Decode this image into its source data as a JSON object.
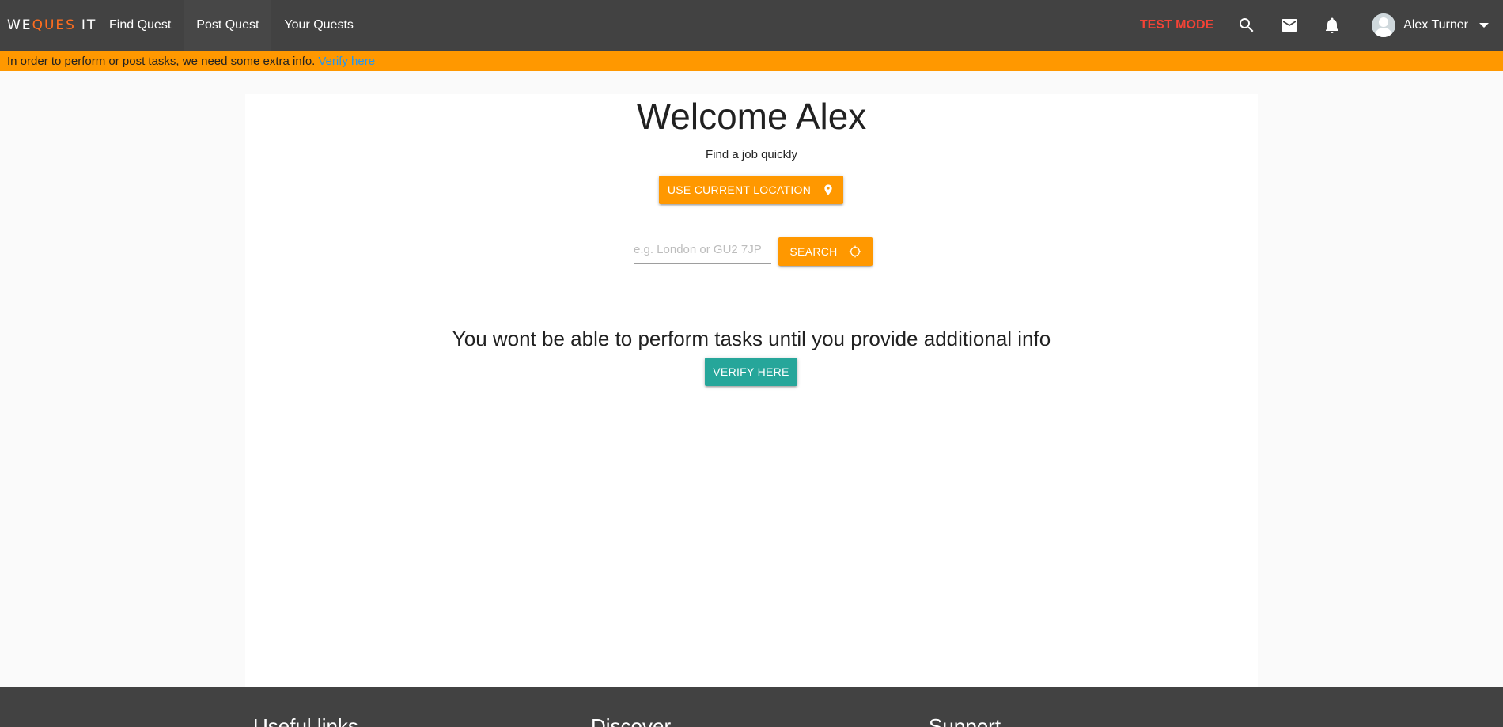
{
  "navbar": {
    "logo": {
      "part1": "WE",
      "part2": "QUES",
      "part3": "IT"
    },
    "items": [
      {
        "label": "Find Quest"
      },
      {
        "label": "Post Quest"
      },
      {
        "label": "Your Quests"
      }
    ],
    "test_mode_label": "TEST MODE",
    "icons": [
      "search-icon",
      "mail-icon",
      "bell-icon"
    ],
    "user_name": "Alex Turner"
  },
  "banner": {
    "text": "In order to perform or post tasks, we need some extra info.",
    "link_label": "Verify here"
  },
  "main": {
    "welcome": "Welcome Alex",
    "subtitle": "Find a job quickly",
    "location_button_label": "USE CURRENT LOCATION",
    "search_placeholder": "e.g. London or GU2 7JP",
    "search_button_label": "SEARCH",
    "warning_text": "You wont be able to perform tasks until you provide additional info",
    "verify_button_label": "VERIFY HERE"
  },
  "footer": {
    "columns": [
      "Useful links",
      "Discover",
      "Support"
    ]
  },
  "colors": {
    "navbar": "#424242",
    "accent_orange": "#ff9800",
    "teal": "#26a69a",
    "test_mode_red": "#f44336",
    "link_blue": "#2196f3"
  }
}
